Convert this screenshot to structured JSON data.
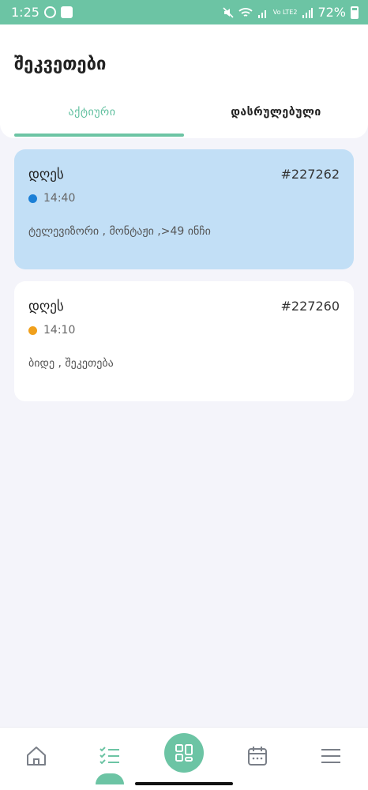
{
  "status_bar": {
    "time": "1:25",
    "battery": "72%",
    "network": "Vo LTE2"
  },
  "header": {
    "title": "შეკვეთები",
    "tabs": [
      {
        "label": "აქტიური",
        "active": true
      },
      {
        "label": "დასრულებული",
        "active": false
      }
    ]
  },
  "orders": [
    {
      "day": "დღეს",
      "id": "#227262",
      "time": "14:40",
      "status_color": "#1b7fd6",
      "description": "ტელევიზორი , მონტაჟი ,>49 ინჩი",
      "background": "#c2dff6"
    },
    {
      "day": "დღეს",
      "id": "#227260",
      "time": "14:10",
      "status_color": "#f0a01c",
      "description": "ბიდე , შეკეთება",
      "background": "#ffffff"
    }
  ],
  "bottom_nav": {
    "items": [
      "home-icon",
      "tasks-icon",
      "dashboard-icon",
      "calendar-icon",
      "menu-icon"
    ],
    "active": "tasks-icon"
  },
  "colors": {
    "accent": "#6cc4a4",
    "background": "#f4f4fa"
  }
}
